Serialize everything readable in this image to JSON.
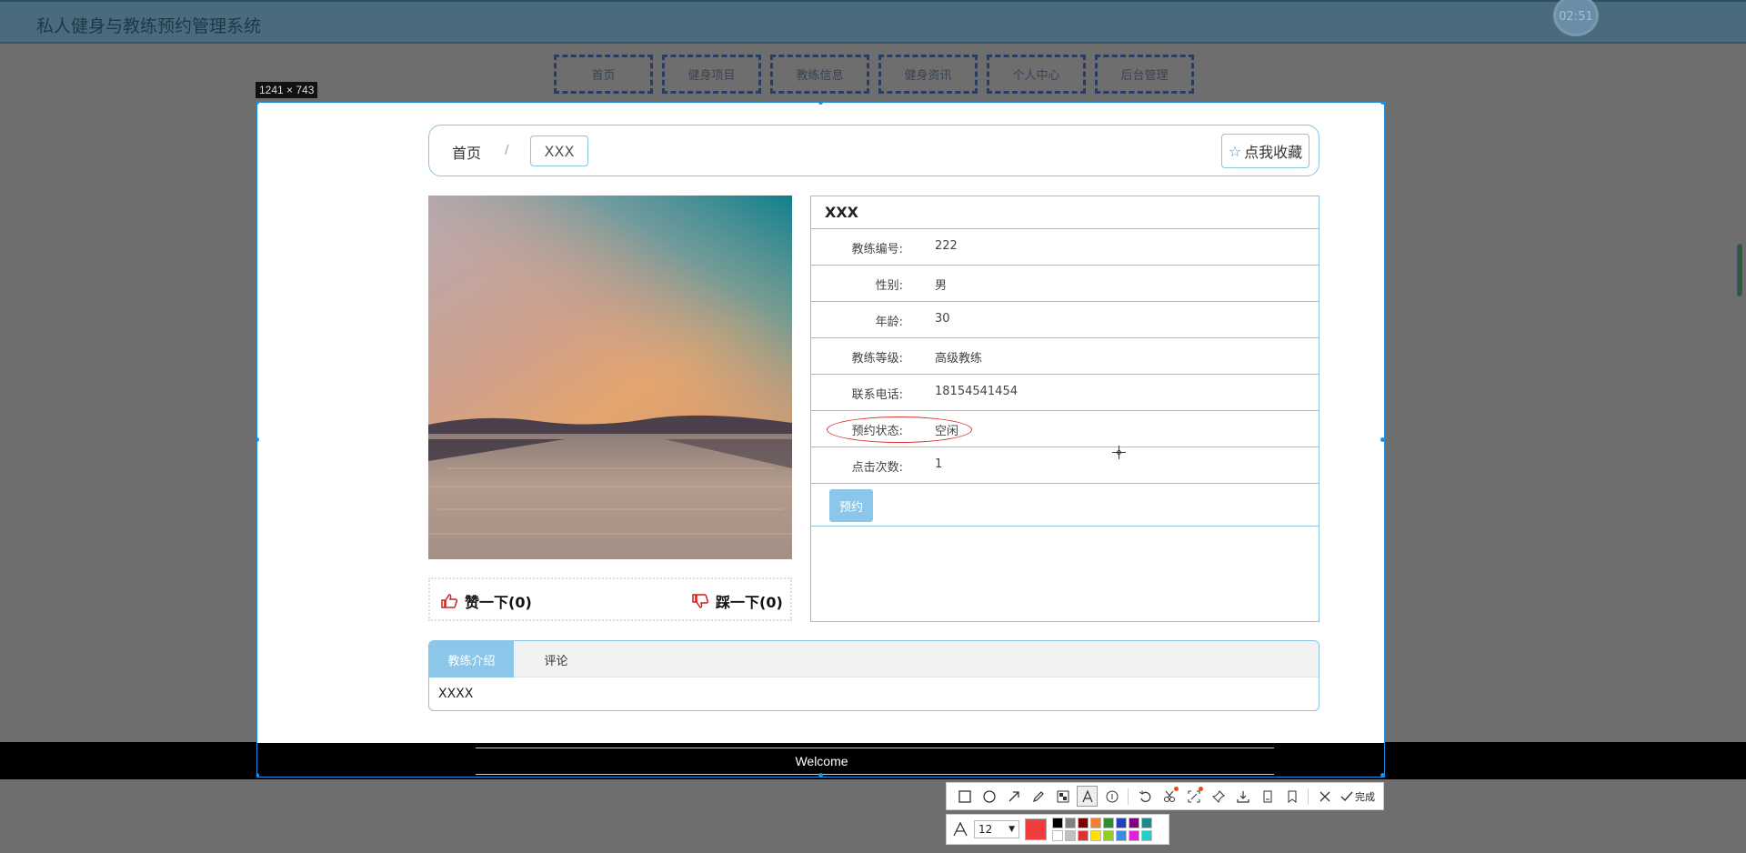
{
  "app": {
    "title": "私人健身与教练预约管理系统",
    "clock": "02:51"
  },
  "nav": {
    "items": [
      "首页",
      "健身项目",
      "教练信息",
      "健身资讯",
      "个人中心",
      "后台管理"
    ]
  },
  "selection": {
    "size_label": "1241 × 743"
  },
  "breadcrumb": {
    "home": "首页",
    "separator": "/",
    "current": "XXX"
  },
  "favorite": {
    "label": "点我收藏"
  },
  "votes": {
    "like_label": "赞一下(0)",
    "dislike_label": "踩一下(0)"
  },
  "coach": {
    "name": "XXX",
    "fields": [
      {
        "label": "教练编号:",
        "value": "222"
      },
      {
        "label": "性别:",
        "value": "男"
      },
      {
        "label": "年龄:",
        "value": "30"
      },
      {
        "label": "教练等级:",
        "value": "高级教练"
      },
      {
        "label": "联系电话:",
        "value": "18154541454"
      },
      {
        "label": "预约状态:",
        "value": "空闲"
      },
      {
        "label": "点击次数:",
        "value": "1"
      }
    ],
    "book_label": "预约"
  },
  "tabs": {
    "items": [
      "教练介绍",
      "评论"
    ],
    "active": "教练介绍",
    "content": "XXXX"
  },
  "footer": {
    "text": "Welcome"
  },
  "toolbar": {
    "done_label": "完成",
    "font_size": "12",
    "current_color": "#f03c3c",
    "palette": [
      "#000000",
      "#808080",
      "#800000",
      "#f08030",
      "#2e8b2e",
      "#2040c0",
      "#800080",
      "#1a8a8a",
      "#ffffff",
      "#c0c0c0",
      "#e03030",
      "#ffe000",
      "#90d020",
      "#3b8de0",
      "#e020e0",
      "#20d0d0"
    ]
  }
}
